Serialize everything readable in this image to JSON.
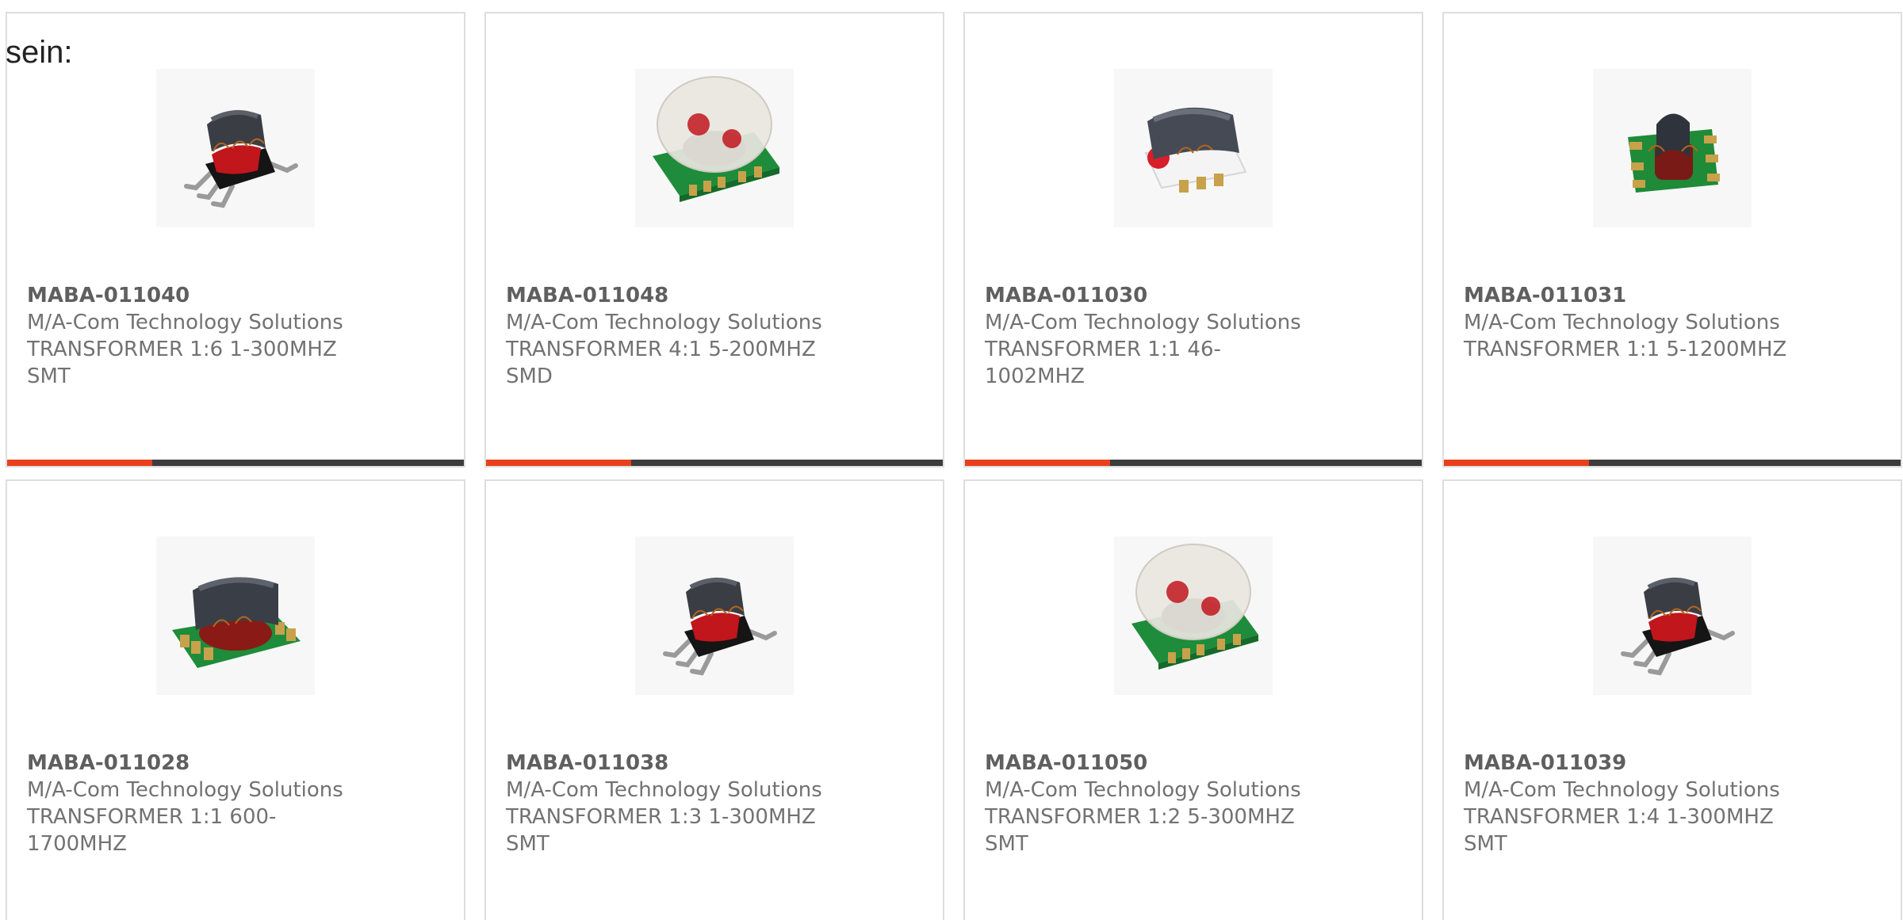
{
  "prefix_text": "sein:",
  "colors": {
    "accent": "#e8401c",
    "bar": "#3c3c3c",
    "border": "#dedede",
    "text": "#727272"
  },
  "products": [
    {
      "part": "MABA-011040",
      "maker": "M/A-Com Technology Solutions",
      "line1": "TRANSFORMER 1:6 1-300MHZ",
      "line2": "SMT",
      "image": "smt-transformer-gullwing"
    },
    {
      "part": "MABA-011048",
      "maker": "M/A-Com Technology Solutions",
      "line1": "TRANSFORMER 4:1 5-200MHZ",
      "line2": "SMD",
      "image": "smd-transformer-dome"
    },
    {
      "part": "MABA-011030",
      "maker": "M/A-Com Technology Solutions",
      "line1": "TRANSFORMER 1:1 46-1002MHZ",
      "line2": "",
      "image": "smt-transformer-white"
    },
    {
      "part": "MABA-011031",
      "maker": "M/A-Com Technology Solutions",
      "line1": "TRANSFORMER 1:1 5-1200MHZ",
      "line2": "",
      "image": "smt-transformer-pcb-small"
    },
    {
      "part": "MABA-011028",
      "maker": "M/A-Com Technology Solutions",
      "line1": "TRANSFORMER 1:1 600-",
      "line2": "1700MHZ",
      "image": "smt-transformer-pcb"
    },
    {
      "part": "MABA-011038",
      "maker": "M/A-Com Technology Solutions",
      "line1": "TRANSFORMER 1:3 1-300MHZ",
      "line2": "SMT",
      "image": "smt-transformer-gullwing"
    },
    {
      "part": "MABA-011050",
      "maker": "M/A-Com Technology Solutions",
      "line1": "TRANSFORMER 1:2 5-300MHZ",
      "line2": "SMT",
      "image": "smd-transformer-dome"
    },
    {
      "part": "MABA-011039",
      "maker": "M/A-Com Technology Solutions",
      "line1": "TRANSFORMER 1:4 1-300MHZ",
      "line2": "SMT",
      "image": "smt-transformer-gullwing"
    }
  ]
}
